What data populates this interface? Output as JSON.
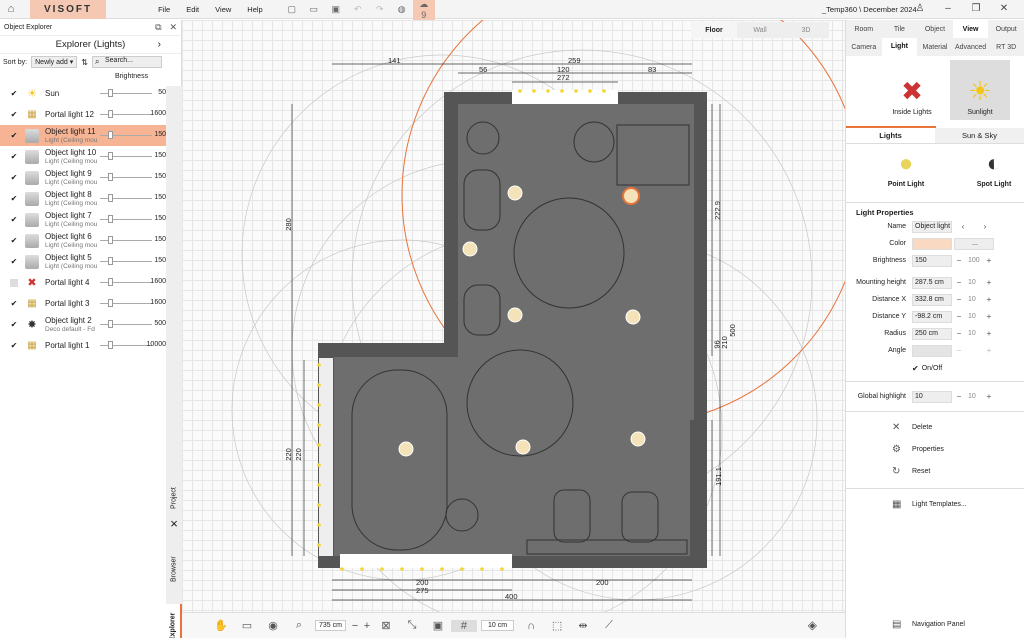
{
  "app": {
    "logo": "VISOFT",
    "doc_title": "_Temp360 \\ December 2024",
    "menu": [
      "File",
      "Edit",
      "View",
      "Help"
    ],
    "badge": "9"
  },
  "left": {
    "panel_title": "Object Explorer",
    "explorer_title": "Explorer (Lights)",
    "sort_label": "Sort by:",
    "sort_value": "Newly add",
    "search_placeholder": "Search...",
    "brightness_header": "Brightness",
    "lights": [
      {
        "name": "Sun",
        "sub": "",
        "value": "50",
        "icon": "sun",
        "checked": true,
        "fill": 0.5
      },
      {
        "name": "Portal light 12",
        "sub": "",
        "value": "1600",
        "icon": "portal",
        "checked": true,
        "fill": 0.5
      },
      {
        "name": "Object light 11",
        "sub": "Light (Ceiling mou",
        "value": "150",
        "icon": "obj",
        "checked": true,
        "selected": true,
        "fill": 0.5
      },
      {
        "name": "Object light 10",
        "sub": "Light (Ceiling mou",
        "value": "150",
        "icon": "obj",
        "checked": true,
        "fill": 0.5
      },
      {
        "name": "Object light 9",
        "sub": "Light (Ceiling mou",
        "value": "150",
        "icon": "obj",
        "checked": true,
        "fill": 0.5
      },
      {
        "name": "Object light 8",
        "sub": "Light (Ceiling mou",
        "value": "150",
        "icon": "obj",
        "checked": true,
        "fill": 0.5
      },
      {
        "name": "Object light 7",
        "sub": "Light (Ceiling mou",
        "value": "150",
        "icon": "obj",
        "checked": true,
        "fill": 0.5
      },
      {
        "name": "Object light 6",
        "sub": "Light (Ceiling mou",
        "value": "150",
        "icon": "obj",
        "checked": true,
        "fill": 0.5
      },
      {
        "name": "Object light 5",
        "sub": "Light (Ceiling mou",
        "value": "150",
        "icon": "obj",
        "checked": true,
        "fill": 0.5
      },
      {
        "name": "Portal light 4",
        "sub": "",
        "value": "1600",
        "icon": "portaloff",
        "checked": false,
        "fill": 0.5
      },
      {
        "name": "Portal light 3",
        "sub": "",
        "value": "1600",
        "icon": "portal",
        "checked": true,
        "fill": 0.5
      },
      {
        "name": "Object light 2",
        "sub": "Deco default - Fd",
        "value": "500",
        "icon": "deco",
        "checked": true,
        "fill": 0.5
      },
      {
        "name": "Portal light 1",
        "sub": "",
        "value": "10000",
        "icon": "portal",
        "checked": true,
        "fill": 0.5
      }
    ],
    "vtabs": [
      "Project",
      "Browser",
      "Explorer"
    ]
  },
  "canvas": {
    "view_tabs": [
      "Floor",
      "Wall",
      "3D"
    ],
    "dims": {
      "d141": "141",
      "d259": "259",
      "d56": "56",
      "d120": "120",
      "d83": "83",
      "d272": "272",
      "d280": "280",
      "d2229": "222.9",
      "d500": "500",
      "d210": "210",
      "d96": "96",
      "d220a": "220",
      "d220b": "220",
      "d1911": "191.1",
      "d200a": "200",
      "d200b": "200",
      "d275": "275",
      "d400": "400"
    }
  },
  "bottom": {
    "zoom": "735 cm",
    "grid": "10 cm"
  },
  "right": {
    "tabs1": [
      "Room",
      "Tile",
      "Object",
      "View",
      "Output"
    ],
    "tabs2": [
      "Camera",
      "Light",
      "Material",
      "Advanced",
      "RT 3D"
    ],
    "modes": [
      "Inside Lights",
      "Sunlight"
    ],
    "tabs3": [
      "Lights",
      "Sun & Sky"
    ],
    "light_types": [
      "Point Light",
      "Spot Light"
    ],
    "props_title": "Light Properties",
    "props": {
      "name_label": "Name",
      "name_value": "Object light",
      "color_label": "Color",
      "color_btn": "...",
      "brightness_label": "Brightness",
      "brightness_value": "150",
      "brightness_max": "100",
      "mount_label": "Mounting height",
      "mount_value": "287.5 cm",
      "mount_max": "10",
      "dx_label": "Distance X",
      "dx_value": "332.8 cm",
      "dx_max": "10",
      "dy_label": "Distance Y",
      "dy_value": "-98.2 cm",
      "dy_max": "10",
      "radius_label": "Radius",
      "radius_value": "250 cm",
      "radius_max": "10",
      "angle_label": "Angle",
      "onoff_label": "On/Off",
      "gh_label": "Global highlight",
      "gh_value": "10",
      "gh_max": "10"
    },
    "actions": [
      "Delete",
      "Properties",
      "Reset"
    ],
    "templates": "Light Templates...",
    "nav_panel": "Navigation Panel"
  }
}
